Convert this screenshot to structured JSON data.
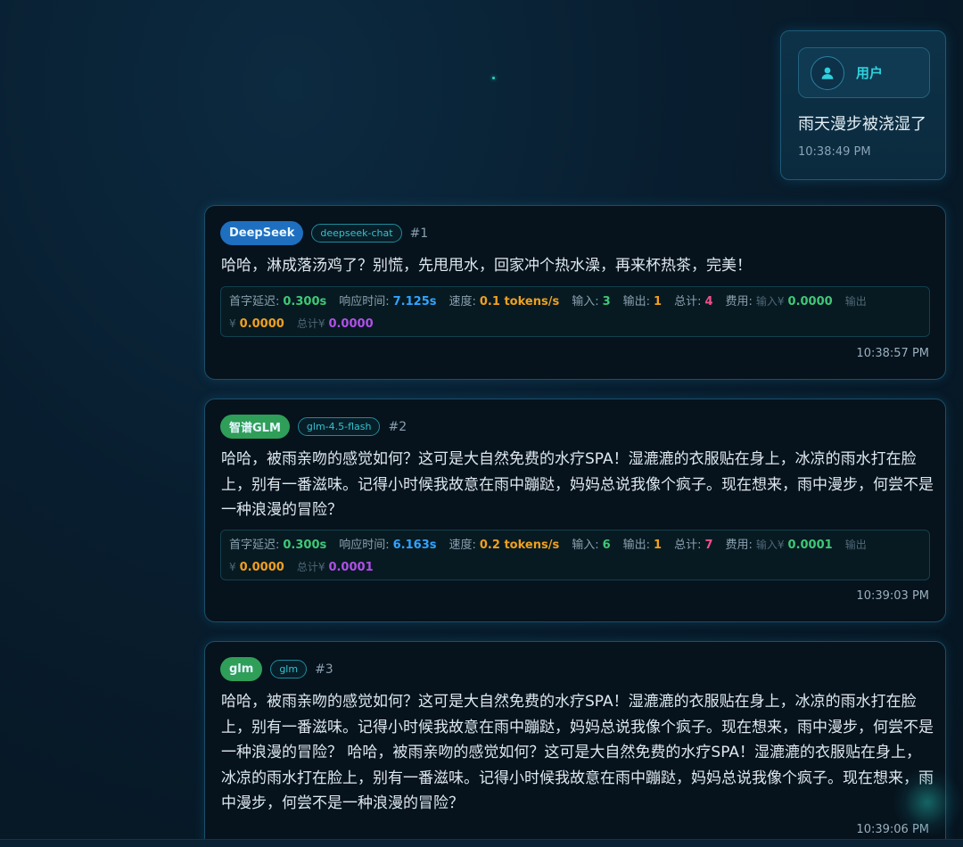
{
  "user_message": {
    "name": "用户",
    "text": "雨天漫步被浇湿了",
    "time": "10:38:49 PM"
  },
  "stat_labels": {
    "first_token": "首字延迟:",
    "response_time": "响应时间:",
    "speed": "速度:",
    "input": "输入:",
    "output": "输出:",
    "total": "总计:",
    "cost": "费用:",
    "cost_in": "输入¥",
    "cost_out": "输出¥",
    "cost_total": "总计¥"
  },
  "messages": [
    {
      "provider": "DeepSeek",
      "provider_color": "#1e6fc0",
      "model": "deepseek-chat",
      "number": "#1",
      "text": "哈哈，淋成落汤鸡了？别慌，先甩甩水，回家冲个热水澡，再来杯热茶，完美！",
      "stats": {
        "first_token": "0.300s",
        "response_time": "7.125s",
        "speed": "0.1 tokens/s",
        "input": "3",
        "output": "1",
        "total": "4",
        "cost_in": "0.0000",
        "cost_out": "0.0000",
        "cost_total": "0.0000"
      },
      "time": "10:38:57 PM"
    },
    {
      "provider": "智谱GLM",
      "provider_color": "#2f9e58",
      "model": "glm-4.5-flash",
      "number": "#2",
      "text": "哈哈，被雨亲吻的感觉如何？这可是大自然免费的水疗SPA！湿漉漉的衣服贴在身上，冰凉的雨水打在脸上，别有一番滋味。记得小时候我故意在雨中蹦跶，妈妈总说我像个疯子。现在想来，雨中漫步，何尝不是一种浪漫的冒险？",
      "stats": {
        "first_token": "0.300s",
        "response_time": "6.163s",
        "speed": "0.2 tokens/s",
        "input": "6",
        "output": "1",
        "total": "7",
        "cost_in": "0.0001",
        "cost_out": "0.0000",
        "cost_total": "0.0001"
      },
      "time": "10:39:03 PM"
    },
    {
      "provider": "glm",
      "provider_color": "#2f9e58",
      "model": "glm",
      "number": "#3",
      "text": "哈哈，被雨亲吻的感觉如何？这可是大自然免费的水疗SPA！湿漉漉的衣服贴在身上，冰凉的雨水打在脸上，别有一番滋味。记得小时候我故意在雨中蹦跶，妈妈总说我像个疯子。现在想来，雨中漫步，何尝不是一种浪漫的冒险？ 哈哈，被雨亲吻的感觉如何？这可是大自然免费的水疗SPA！湿漉漉的衣服贴在身上，冰凉的雨水打在脸上，别有一番滋味。记得小时候我故意在雨中蹦跶，妈妈总说我像个疯子。现在想来，雨中漫步，何尝不是一种浪漫的冒险？",
      "time": "10:39:06 PM"
    }
  ]
}
